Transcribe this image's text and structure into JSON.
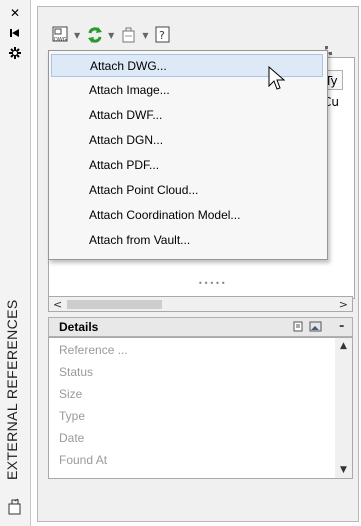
{
  "strip": {
    "title": "EXTERNAL REFERENCES",
    "icons": [
      "close-icon",
      "pin-icon",
      "settings-icon"
    ]
  },
  "toolbar": {
    "buttons": [
      {
        "icon": "attach-dwg-icon",
        "has_dropdown": true
      },
      {
        "icon": "refresh-icon",
        "has_dropdown": true
      },
      {
        "icon": "change-path-icon",
        "has_dropdown": true
      },
      {
        "icon": "help-icon",
        "has_dropdown": false
      }
    ]
  },
  "file_refs": {
    "column_header": "Ty",
    "first_cell": "Cu"
  },
  "menu": {
    "items": [
      {
        "label": "Attach DWG...",
        "highlighted": true
      },
      {
        "label": "Attach Image...",
        "highlighted": false
      },
      {
        "label": "Attach DWF...",
        "highlighted": false
      },
      {
        "label": "Attach DGN...",
        "highlighted": false
      },
      {
        "label": "Attach PDF...",
        "highlighted": false
      },
      {
        "label": "Attach Point Cloud...",
        "highlighted": false
      },
      {
        "label": "Attach Coordination Model...",
        "highlighted": false
      },
      {
        "label": "Attach from Vault...",
        "highlighted": false
      }
    ]
  },
  "details": {
    "title": "Details",
    "collapse": "-",
    "properties": [
      "Reference ...",
      "Status",
      "Size",
      "Type",
      "Date",
      "Found At"
    ]
  },
  "colors": {
    "highlight_bg": "#dde9f6",
    "refresh_green": "#2a9a2a",
    "panel_bg": "#f0f0f0"
  }
}
